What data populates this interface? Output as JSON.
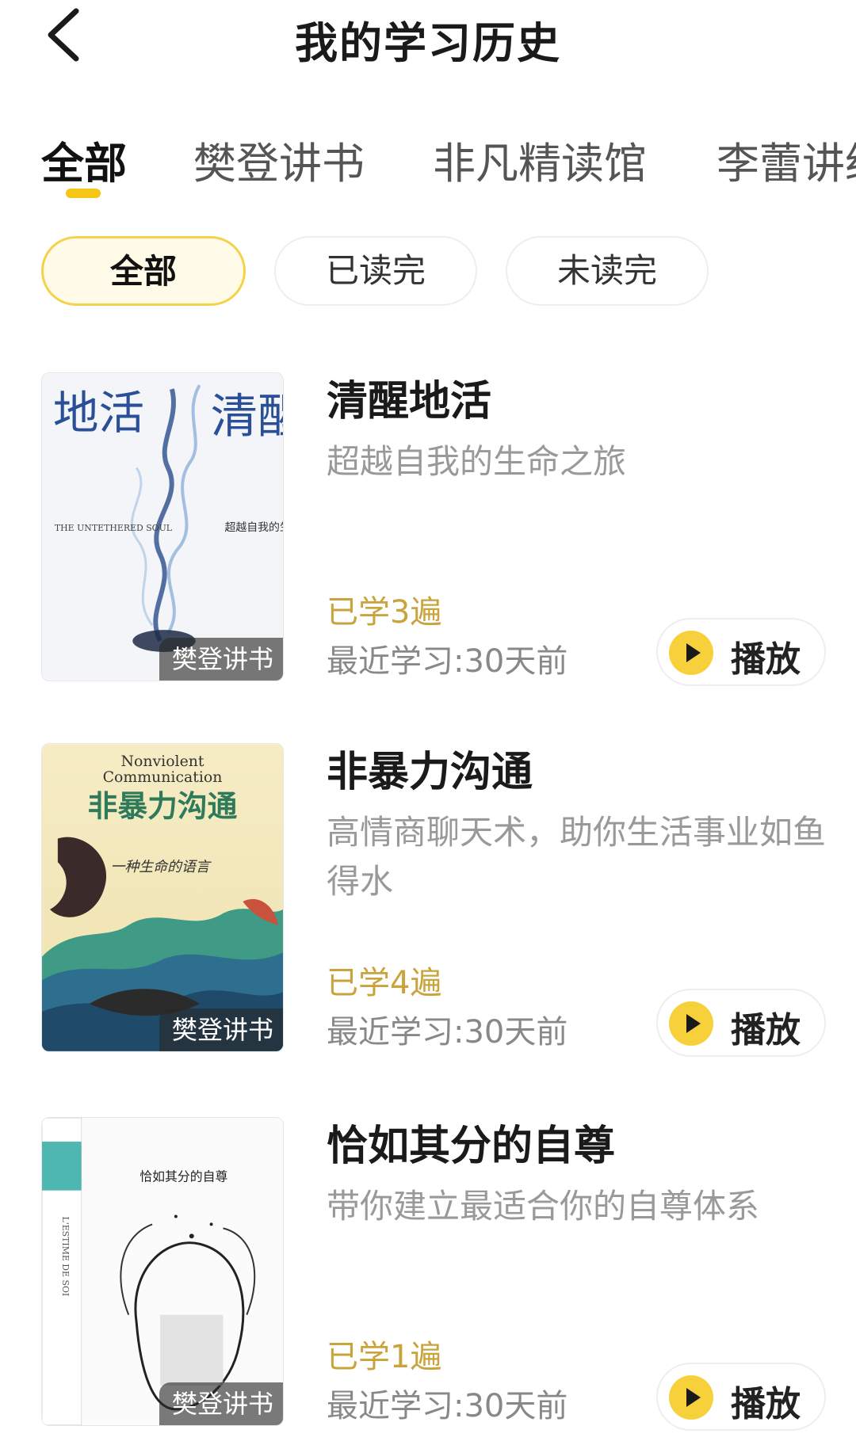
{
  "header": {
    "title": "我的学习历史"
  },
  "source_tabs": [
    {
      "label": "全部"
    },
    {
      "label": "樊登讲书"
    },
    {
      "label": "非凡精读馆"
    },
    {
      "label": "李蕾讲经典"
    }
  ],
  "filters": [
    {
      "label": "全部"
    },
    {
      "label": "已读完"
    },
    {
      "label": "未读完"
    }
  ],
  "books": [
    {
      "title": "清醒地活",
      "subtitle": "超越自我的生命之旅",
      "count": "已学3遍",
      "last": "最近学习:30天前",
      "cover_label": "樊登讲书",
      "play": "播放",
      "cover_text": {
        "cn_title_right": "清醒",
        "cn_title_left": "地活",
        "cn_sub": "超越自我的生命之旅",
        "en_title": "THE UNTETHERED SOUL"
      }
    },
    {
      "title": "非暴力沟通",
      "subtitle": "高情商聊天术，助你生活事业如鱼得水",
      "count": "已学4遍",
      "last": "最近学习:30天前",
      "cover_label": "樊登讲书",
      "play": "播放",
      "cover_text": {
        "en_line1": "Nonviolent",
        "en_line2": "Communication",
        "cn_title": "非暴力沟通",
        "script": "一种生命的语言"
      }
    },
    {
      "title": "恰如其分的自尊",
      "subtitle": "带你建立最适合你的自尊体系",
      "count": "已学1遍",
      "last": "最近学习:30天前",
      "cover_label": "樊登讲书",
      "play": "播放",
      "cover_text": {
        "cn_title": "恰如其分的自尊",
        "spine": "L'ESTIME DE SOI"
      }
    }
  ],
  "colors": {
    "accent": "#f5c518",
    "count": "#c9a33b",
    "muted": "#999999"
  },
  "icons": {
    "back": "back-chevron-icon",
    "play": "play-icon"
  }
}
